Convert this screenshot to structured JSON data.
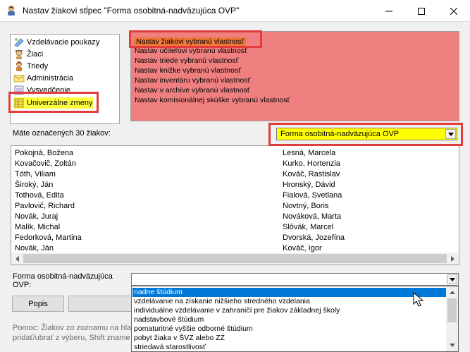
{
  "window": {
    "title": "Nastav žiakovi stĺpec \"Forma osobitná-nadväzujúca OVP\"",
    "app_icon": "teacher-icon"
  },
  "nav": {
    "items": [
      {
        "label": "Vzdelávacie poukazy",
        "icon": "voucher-icon"
      },
      {
        "label": "Žiaci",
        "icon": "students-icon"
      },
      {
        "label": "Triedy",
        "icon": "classes-icon"
      },
      {
        "label": "Administrácia",
        "icon": "envelope-icon"
      },
      {
        "label": "Vysvedčenie",
        "icon": "certificate-icon"
      },
      {
        "label": "Univerzálne zmeny",
        "icon": "universal-changes-icon",
        "selected": true
      }
    ]
  },
  "actions": {
    "items": [
      "Nastav žiakovi vybranú vlastnosť",
      "Nastav učiteľovi vybranú vlastnosť",
      "Nastav triede vybranú vlastnosť",
      "Nastav knižke vybranú vlastnosť",
      "Nastav inventáru vybranú vlastnosť",
      "Nastav v archíve vybranú vlastnosť",
      "Nastav komisionálnej skúške vybranú vlastnosť"
    ]
  },
  "selection": {
    "count_label": "Máte označených 30 žiakov:",
    "field_value": "Forma osobitná-nadväzujúca OVP"
  },
  "students": {
    "left": [
      "Pokojná, Božena",
      "Kovačovič, Zoltán",
      "Tóth, Viliam",
      "Široký, Ján",
      "Tothová, Edita",
      "Pavlovič, Richard",
      "Novák, Juraj",
      "Malík, Michal",
      "Fedorková, Martina",
      "Novák, Ján"
    ],
    "right": [
      "Lesná, Marcela",
      "Kurko, Hortenzia",
      "Kováč, Rastislav",
      "Hronský, Dávid",
      "Fialová, Svetlana",
      "Novtný, Boris",
      "Nováková, Marta",
      "Slôvák, Marcel",
      "Dvorská, Jozefína",
      "Kováč, Igor"
    ]
  },
  "ovp": {
    "label": "Forma osobitná-nadväzujúca OVP:",
    "value": "",
    "options": [
      "riadne štúdium",
      "vzdelávanie na získanie nižšieho stredného vzdelania",
      "individuálne vzdelávanie v zahraničí pre žiakov základnej školy",
      "nadstavbové štúdium",
      "pomaturitné vyššie odborné štúdium",
      "pobyt žiaka v ŠVZ alebo ZZ",
      "striedavá starostlivosť"
    ],
    "selected_index": 0
  },
  "buttons": {
    "describe": "Popis"
  },
  "help": {
    "line1": "Pomoc: Žiakov zo zoznamu na hla",
    "line2": "pridať/ubrať z výberu, Shift zname"
  },
  "colors": {
    "actions_bg": "#f08080",
    "highlight_border": "#e23c3c",
    "selected_action": "#f07838",
    "field_select_bg": "#ffff00",
    "list_selection": "#0078d7"
  }
}
